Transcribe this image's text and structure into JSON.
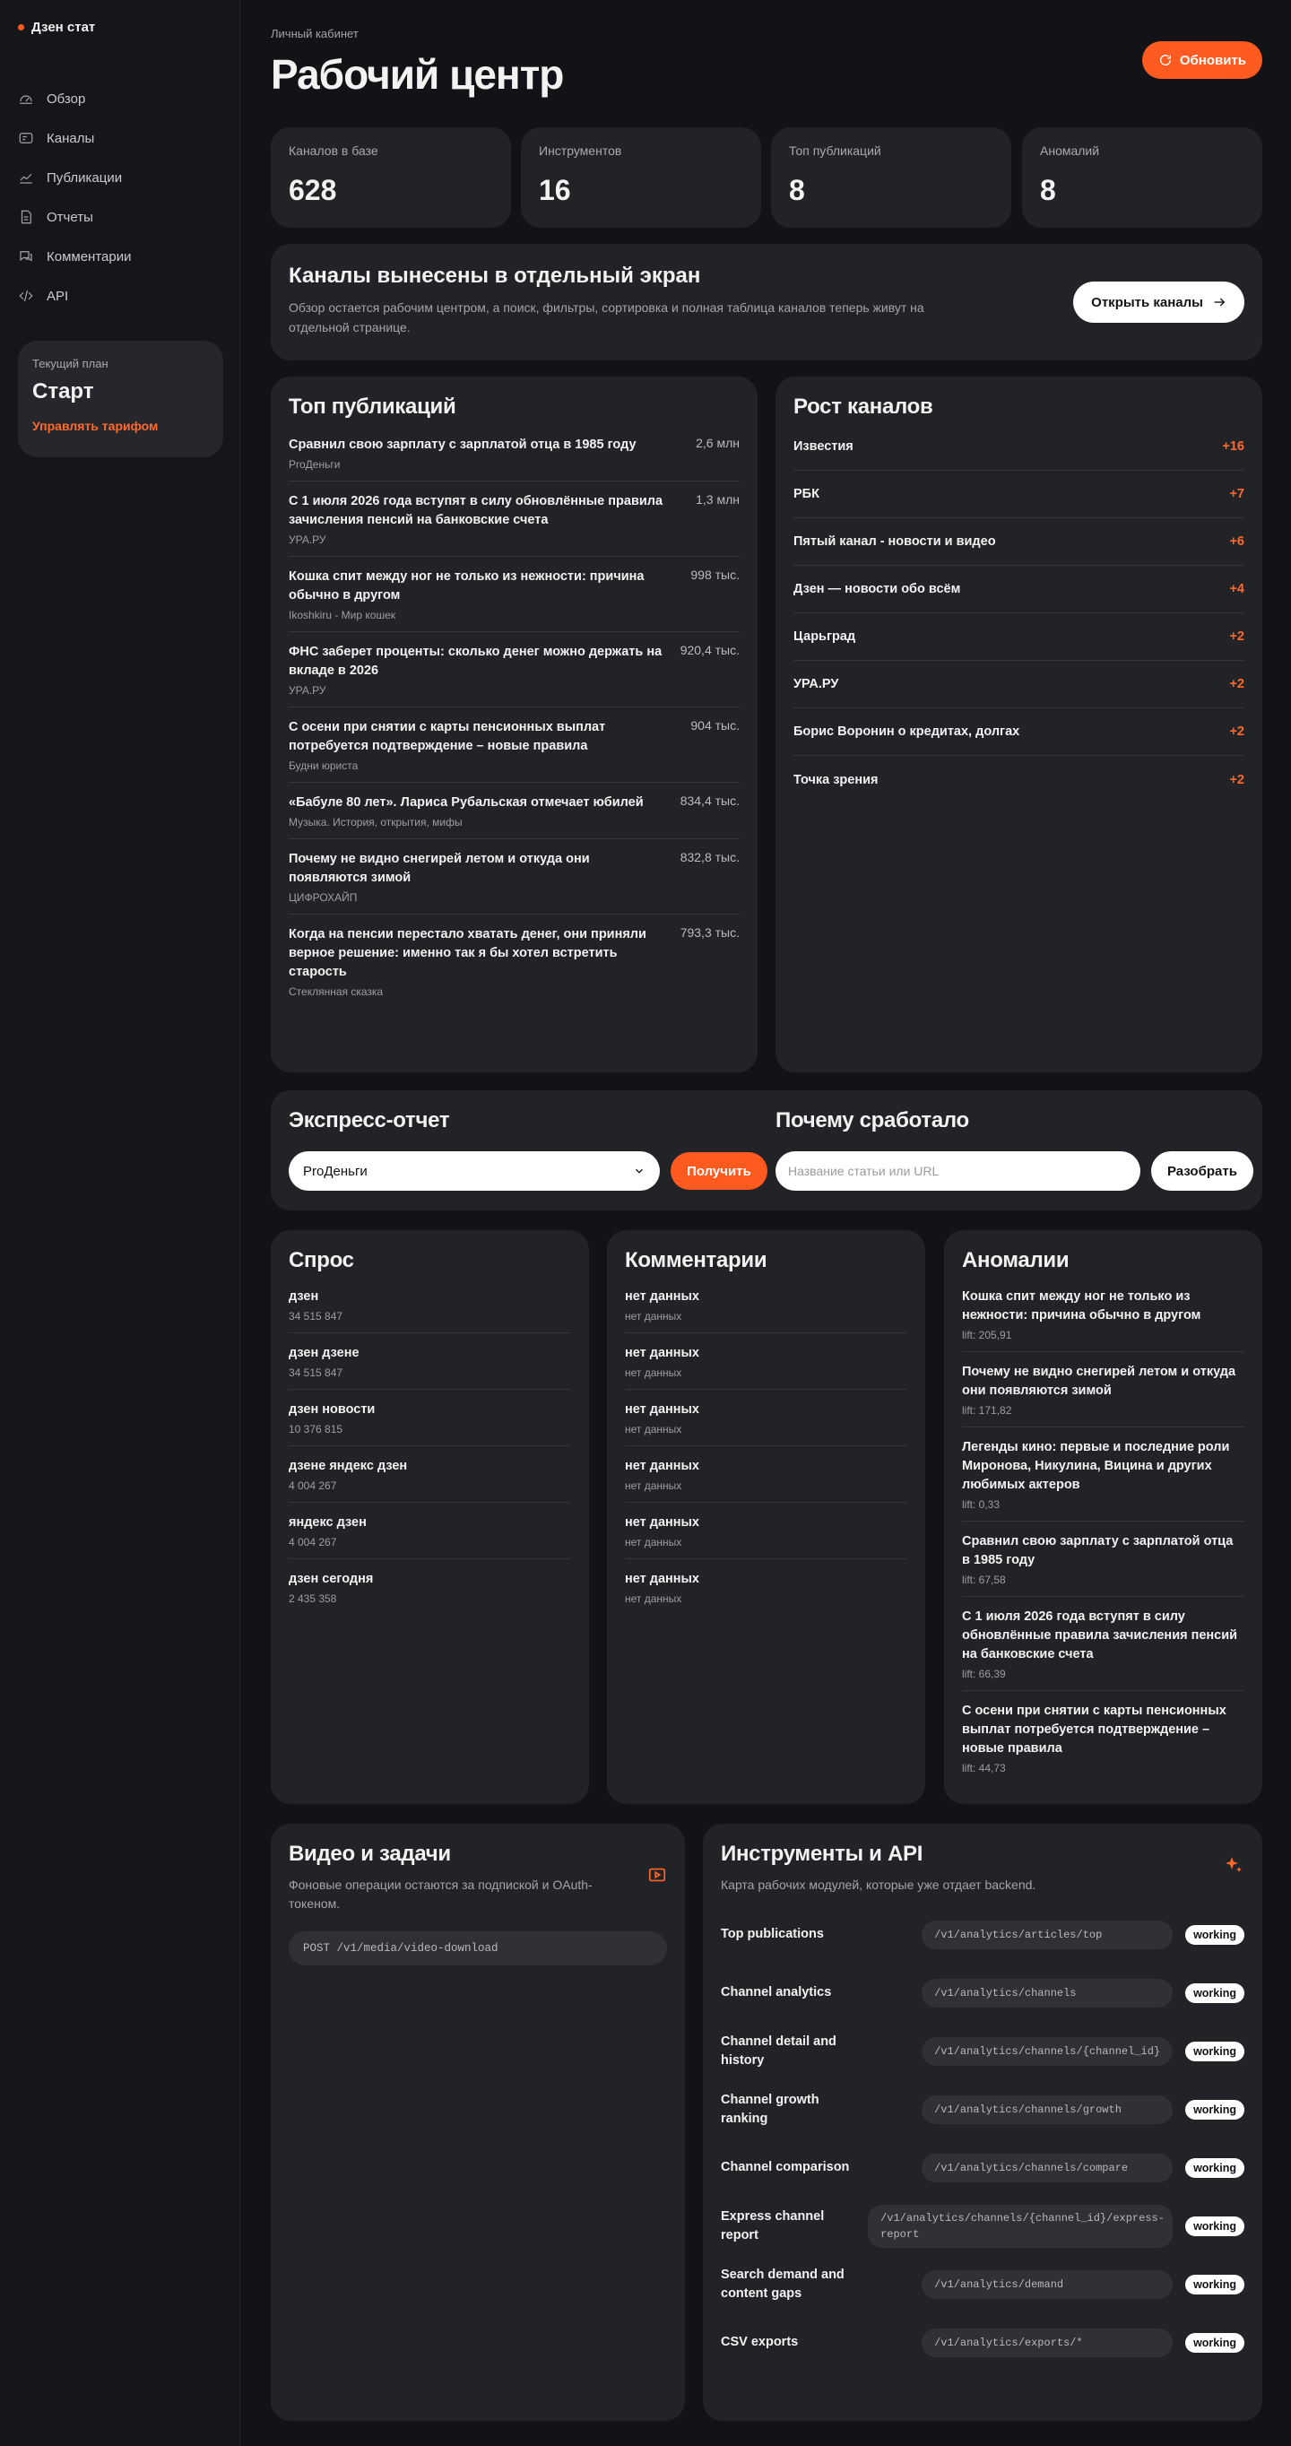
{
  "sidebar": {
    "brand": "Дзен стат",
    "nav": [
      {
        "label": "Обзор",
        "icon": "dashboard-icon"
      },
      {
        "label": "Каналы",
        "icon": "channels-icon"
      },
      {
        "label": "Публикации",
        "icon": "chart-line-icon"
      },
      {
        "label": "Отчеты",
        "icon": "report-icon"
      },
      {
        "label": "Комментарии",
        "icon": "comments-icon"
      },
      {
        "label": "API",
        "icon": "code-icon"
      }
    ],
    "plan": {
      "label": "Текущий план",
      "name": "Старт",
      "link": "Управлять тарифом"
    }
  },
  "header": {
    "crumb": "Личный кабинет",
    "title": "Рабочий центр",
    "refresh": "Обновить"
  },
  "stats": [
    {
      "label": "Каналов в базе",
      "value": "628"
    },
    {
      "label": "Инструментов",
      "value": "16"
    },
    {
      "label": "Топ публикаций",
      "value": "8"
    },
    {
      "label": "Аномалий",
      "value": "8"
    }
  ],
  "banner": {
    "title": "Каналы вынесены в отдельный экран",
    "text": "Обзор остается рабочим центром, а поиск, фильтры, сортировка и полная таблица каналов теперь живут на отдельной странице.",
    "button": "Открыть каналы"
  },
  "top": {
    "title": "Топ публикаций",
    "items": [
      {
        "title": "Сравнил свою зарплату с зарплатой отца в 1985 году",
        "source": "ProДеньги",
        "views": "2,6 млн"
      },
      {
        "title": "С 1 июля 2026 года вступят в силу обновлённые правила зачисления пенсий на банковские счета",
        "source": "УРА.РУ",
        "views": "1,3 млн"
      },
      {
        "title": "Кошка спит между ног не только из нежности: причина обычно в другом",
        "source": "Ikoshkiru - Мир кошек",
        "views": "998 тыс."
      },
      {
        "title": "ФНС заберет проценты: сколько денег можно держать на вкладе в 2026",
        "source": "УРА.РУ",
        "views": "920,4 тыс."
      },
      {
        "title": "С осени при снятии с карты пенсионных выплат потребуется подтверждение – новые правила",
        "source": "Будни юриста",
        "views": "904 тыс."
      },
      {
        "title": "«Бабуле 80 лет». Лариса Рубальская отмечает юбилей",
        "source": "Музыка. История, открытия, мифы",
        "views": "834,4 тыс."
      },
      {
        "title": "Почему не видно снегирей летом и откуда они появляются зимой",
        "source": "ЦИФРОХАЙП",
        "views": "832,8 тыс."
      },
      {
        "title": "Когда на пенсии перестало хватать денег, они приняли верное решение: именно так я бы хотел встретить старость",
        "source": "Стеклянная сказка",
        "views": "793,3 тыс."
      }
    ]
  },
  "growth": {
    "title": "Рост каналов",
    "items": [
      {
        "name": "Известия",
        "value": "+16"
      },
      {
        "name": "РБК",
        "value": "+7"
      },
      {
        "name": "Пятый канал - новости и видео",
        "value": "+6"
      },
      {
        "name": "Дзен — новости обо всём",
        "value": "+4"
      },
      {
        "name": "Царьград",
        "value": "+2"
      },
      {
        "name": "УРА.РУ",
        "value": "+2"
      },
      {
        "name": "Борис Воронин о кредитах, долгах",
        "value": "+2"
      },
      {
        "name": "Точка зрения",
        "value": "+2"
      }
    ]
  },
  "express": {
    "title": "Экспресс-отчет",
    "selected": "ProДеньги",
    "button": "Получить"
  },
  "why": {
    "title": "Почему сработало",
    "placeholder": "Название статьи или URL",
    "button": "Разобрать"
  },
  "demand": {
    "title": "Спрос",
    "items": [
      {
        "q": "дзен",
        "v": "34 515 847"
      },
      {
        "q": "дзен дзене",
        "v": "34 515 847"
      },
      {
        "q": "дзен новости",
        "v": "10 376 815"
      },
      {
        "q": "дзене яндекс дзен",
        "v": "4 004 267"
      },
      {
        "q": "яндекс дзен",
        "v": "4 004 267"
      },
      {
        "q": "дзен сегодня",
        "v": "2 435 358"
      }
    ]
  },
  "comments": {
    "title": "Комментарии",
    "items": [
      {
        "q": "нет данных",
        "v": "нет данных"
      },
      {
        "q": "нет данных",
        "v": "нет данных"
      },
      {
        "q": "нет данных",
        "v": "нет данных"
      },
      {
        "q": "нет данных",
        "v": "нет данных"
      },
      {
        "q": "нет данных",
        "v": "нет данных"
      },
      {
        "q": "нет данных",
        "v": "нет данных"
      }
    ]
  },
  "anomalies": {
    "title": "Аномалии",
    "items": [
      {
        "title": "Кошка спит между ног не только из нежности: причина обычно в другом",
        "lift": "lift: 205,91"
      },
      {
        "title": "Почему не видно снегирей летом и откуда они появляются зимой",
        "lift": "lift: 171,82"
      },
      {
        "title": "Легенды кино: первые и последние роли Миронова, Никулина, Вицина и других любимых актеров",
        "lift": "lift: 0,33"
      },
      {
        "title": "Сравнил свою зарплату с зарплатой отца в 1985 году",
        "lift": "lift: 67,58"
      },
      {
        "title": "С 1 июля 2026 года вступят в силу обновлённые правила зачисления пенсий на банковские счета",
        "lift": "lift: 66,39"
      },
      {
        "title": "С осени при снятии с карты пенсионных выплат потребуется подтверждение – новые правила",
        "lift": "lift: 44,73"
      }
    ]
  },
  "video": {
    "title": "Видео и задачи",
    "desc": "Фоновые операции остаются за подпиской и OAuth-токеном.",
    "endpoint": "POST /v1/media/video-download"
  },
  "tools": {
    "title": "Инструменты и API",
    "desc": "Карта рабочих модулей, которые уже отдает backend.",
    "items": [
      {
        "name": "Top publications",
        "endpoint": "/v1/analytics/articles/top",
        "status": "working"
      },
      {
        "name": "Channel analytics",
        "endpoint": "/v1/analytics/channels",
        "status": "working"
      },
      {
        "name": "Channel detail and history",
        "endpoint": "/v1/analytics/channels/{channel_id}",
        "status": "working"
      },
      {
        "name": "Channel growth ranking",
        "endpoint": "/v1/analytics/channels/growth",
        "status": "working"
      },
      {
        "name": "Channel comparison",
        "endpoint": "/v1/analytics/channels/compare",
        "status": "working"
      },
      {
        "name": "Express channel report",
        "endpoint": "/v1/analytics/channels/{channel_id}/express-report",
        "status": "working"
      },
      {
        "name": "Search demand and content gaps",
        "endpoint": "/v1/analytics/demand",
        "status": "working"
      },
      {
        "name": "CSV exports",
        "endpoint": "/v1/analytics/exports/*",
        "status": "working"
      }
    ]
  },
  "colors": {
    "accent": "#ff5a1f",
    "background": "#121316",
    "card": "#222327"
  }
}
